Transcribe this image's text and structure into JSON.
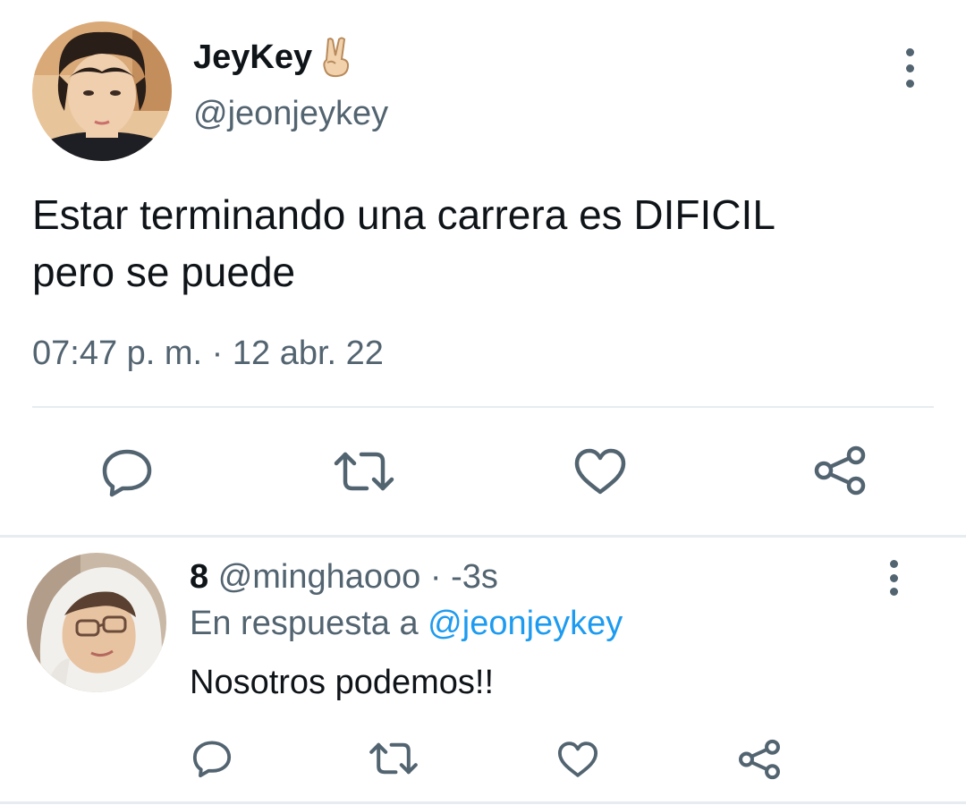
{
  "main_tweet": {
    "author_name": "JeyKey",
    "author_emoji": "victory-hand-emoji",
    "author_handle": "@jeonjeykey",
    "text_line1": "Estar terminando una carrera es DIFICIL",
    "text_line2": "pero se puede",
    "timestamp": "07:47 p. m. · 12 abr. 22",
    "actions": [
      "reply-icon",
      "retweet-icon",
      "like-icon",
      "share-icon"
    ]
  },
  "reply": {
    "author_name": "8",
    "author_handle": "@minghaooo",
    "separator": "·",
    "time": "-3s",
    "reply_prefix": "En respuesta a",
    "reply_mention": "@jeonjeykey",
    "text": "Nosotros podemos!!",
    "actions": [
      "reply-icon",
      "retweet-icon",
      "like-icon",
      "share-icon"
    ]
  },
  "colors": {
    "text_primary": "#0f1419",
    "text_secondary": "#536471",
    "link": "#1d9bf0",
    "divider": "#e6ecf0"
  }
}
